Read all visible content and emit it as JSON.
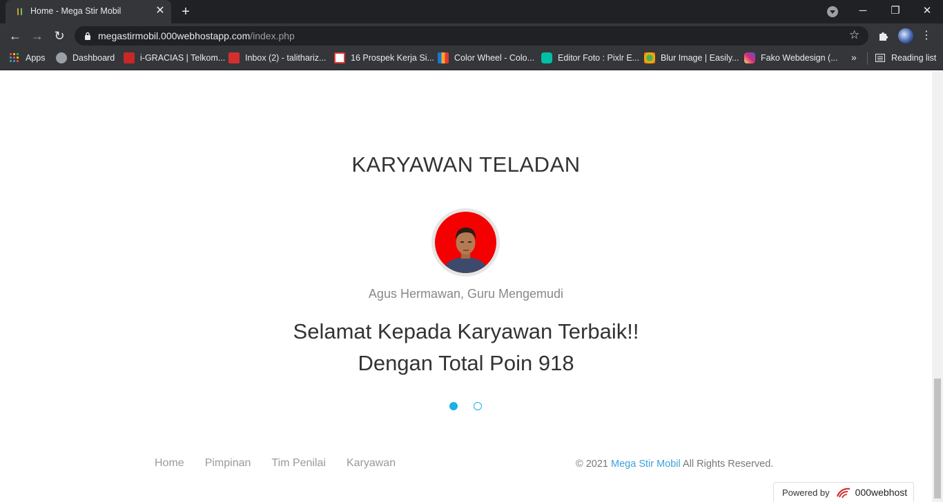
{
  "browser": {
    "tab_title": "Home - Mega Stir Mobil",
    "url_host": "megastirmobil.000webhostapp.com",
    "url_path": "/index.php",
    "bookmarks": [
      {
        "label": "Apps",
        "color": "#e8453c"
      },
      {
        "label": "Dashboard",
        "color": "#9aa0a6"
      },
      {
        "label": "i-GRACIAS | Telkom...",
        "color": "#c62828"
      },
      {
        "label": "Inbox (2) - talithariz...",
        "color": "#d32f2f"
      },
      {
        "label": "16 Prospek Kerja Si...",
        "color": "#e53935"
      },
      {
        "label": "Color Wheel - Colo...",
        "color": "#f9a825"
      },
      {
        "label": "Editor Foto : Pixlr E...",
        "color": "#00bfa5"
      },
      {
        "label": "Blur Image | Easily...",
        "color": "#ffb300"
      },
      {
        "label": "Fako Webdesign (...",
        "color": "#c13584"
      }
    ],
    "more_bookmarks": "»",
    "reading_list": "Reading list"
  },
  "page": {
    "section_title": "KARYAWAN TELADAN",
    "caption": "Agus Hermawan, Guru Mengemudi",
    "quote_line1": "Selamat Kepada Karyawan Terbaik!!",
    "quote_line2": "Dengan Total Poin 918",
    "carousel": {
      "total": 2,
      "active_index": 0
    },
    "accent_color": "#1ab0e8"
  },
  "footer": {
    "links": [
      "Home",
      "Pimpinan",
      "Tim Penilai",
      "Karyawan"
    ],
    "copyright_prefix": "© 2021",
    "brand": "Mega Stir Mobil",
    "copyright_suffix": "All Rights Reserved."
  },
  "powered": {
    "prefix": "Powered by",
    "host": "000webhost"
  }
}
